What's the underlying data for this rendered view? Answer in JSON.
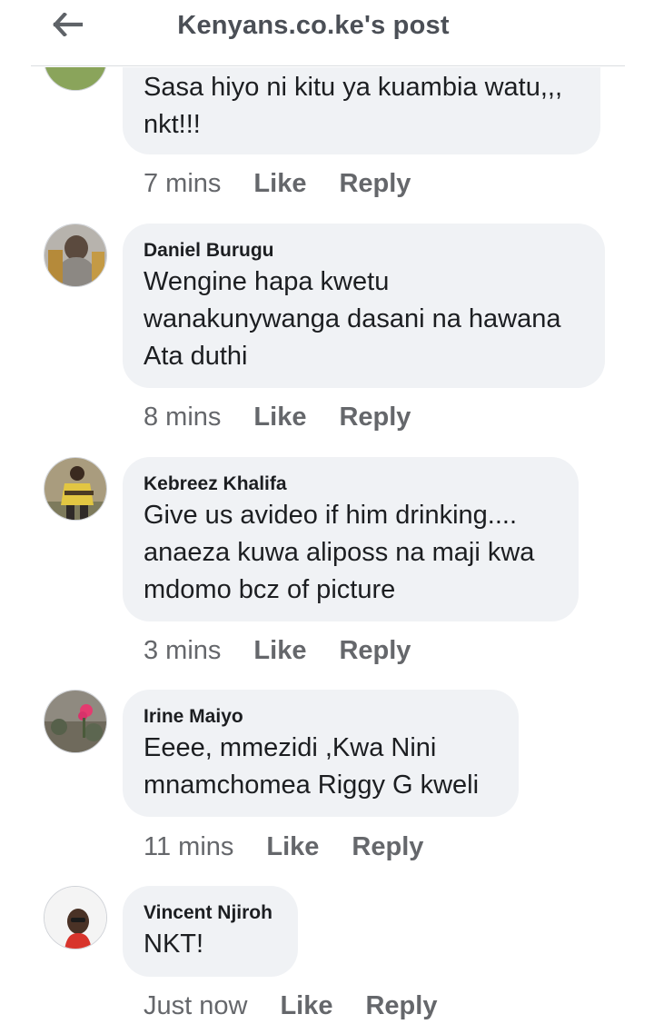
{
  "header": {
    "title": "Kenyans.co.ke's post",
    "back_icon": "arrow-left-icon"
  },
  "comments": [
    {
      "author": "",
      "text": "Sasa hiyo ni kitu ya kuambia watu,,,\nnkt!!!",
      "time": "7 mins",
      "like": "Like",
      "reply": "Reply"
    },
    {
      "author": "Daniel Burugu",
      "text": "Wengine hapa kwetu\nwanakunywanga dasani na hawana\nAta duthi",
      "time": "8 mins",
      "like": "Like",
      "reply": "Reply"
    },
    {
      "author": "Kebreez Khalifa",
      "text": "Give us avideo if him drinking....\nanaeza kuwa aliposs na maji kwa\nmdomo bcz of picture",
      "time": "3 mins",
      "like": "Like",
      "reply": "Reply"
    },
    {
      "author": "Irine Maiyo",
      "text": "Eeee, mmezidi ,Kwa Nini\nmnamchomea Riggy G kweli",
      "time": "11 mins",
      "like": "Like",
      "reply": "Reply"
    },
    {
      "author": "Vincent Njiroh",
      "text": "NKT!",
      "time": "Just now",
      "like": "Like",
      "reply": "Reply"
    }
  ],
  "colors": {
    "bubble": "#f0f2f5",
    "meta_text": "#65676b",
    "title_text": "#4b4f56"
  }
}
